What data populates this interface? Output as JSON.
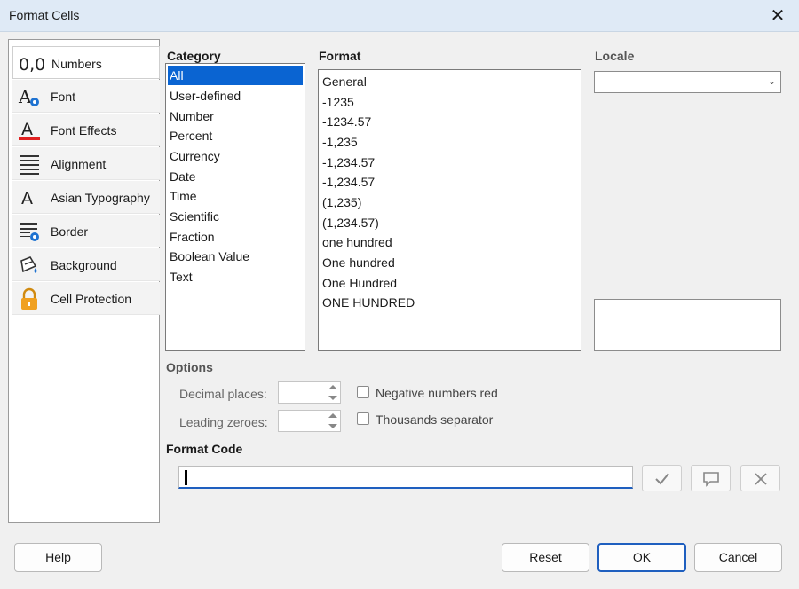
{
  "window": {
    "title": "Format Cells",
    "close_glyph": "✕"
  },
  "sidebar": {
    "items": [
      {
        "label": "Numbers",
        "icon": "numbers-icon",
        "selected": true
      },
      {
        "label": "Font",
        "icon": "font-icon"
      },
      {
        "label": "Font Effects",
        "icon": "font-effects-icon"
      },
      {
        "label": "Alignment",
        "icon": "alignment-icon"
      },
      {
        "label": "Asian Typography",
        "icon": "asian-typography-icon"
      },
      {
        "label": "Border",
        "icon": "border-icon"
      },
      {
        "label": "Background",
        "icon": "background-icon"
      },
      {
        "label": "Cell Protection",
        "icon": "lock-icon"
      }
    ]
  },
  "category": {
    "heading": "Category",
    "items": [
      "All",
      "User-defined",
      "Number",
      "Percent",
      "Currency",
      "Date",
      "Time",
      "Scientific",
      "Fraction",
      "Boolean Value",
      "Text"
    ],
    "selected_index": 0
  },
  "format": {
    "heading": "Format",
    "items": [
      "General",
      "-1235",
      "-1234.57",
      "-1,235",
      "-1,234.57",
      "-1,234.57",
      "(1,235)",
      "(1,234.57)",
      "one hundred",
      "One hundred",
      "One Hundred",
      "ONE HUNDRED"
    ]
  },
  "locale": {
    "heading": "Locale",
    "value": ""
  },
  "options": {
    "heading": "Options",
    "decimal_places_label": "Decimal places:",
    "decimal_places_value": "",
    "leading_zeroes_label": "Leading zeroes:",
    "leading_zeroes_value": "",
    "negative_red_label": "Negative numbers red",
    "negative_red_checked": false,
    "thousands_separator_label": "Thousands separator",
    "thousands_separator_checked": false
  },
  "format_code": {
    "heading": "Format Code",
    "value": ""
  },
  "buttons": {
    "help": "Help",
    "reset": "Reset",
    "ok": "OK",
    "cancel": "Cancel"
  },
  "colors": {
    "accent": "#0a64d2",
    "titlebar": "#dfeaf6",
    "font_effects_underline": "#e02020",
    "lock": "#f0a020"
  }
}
